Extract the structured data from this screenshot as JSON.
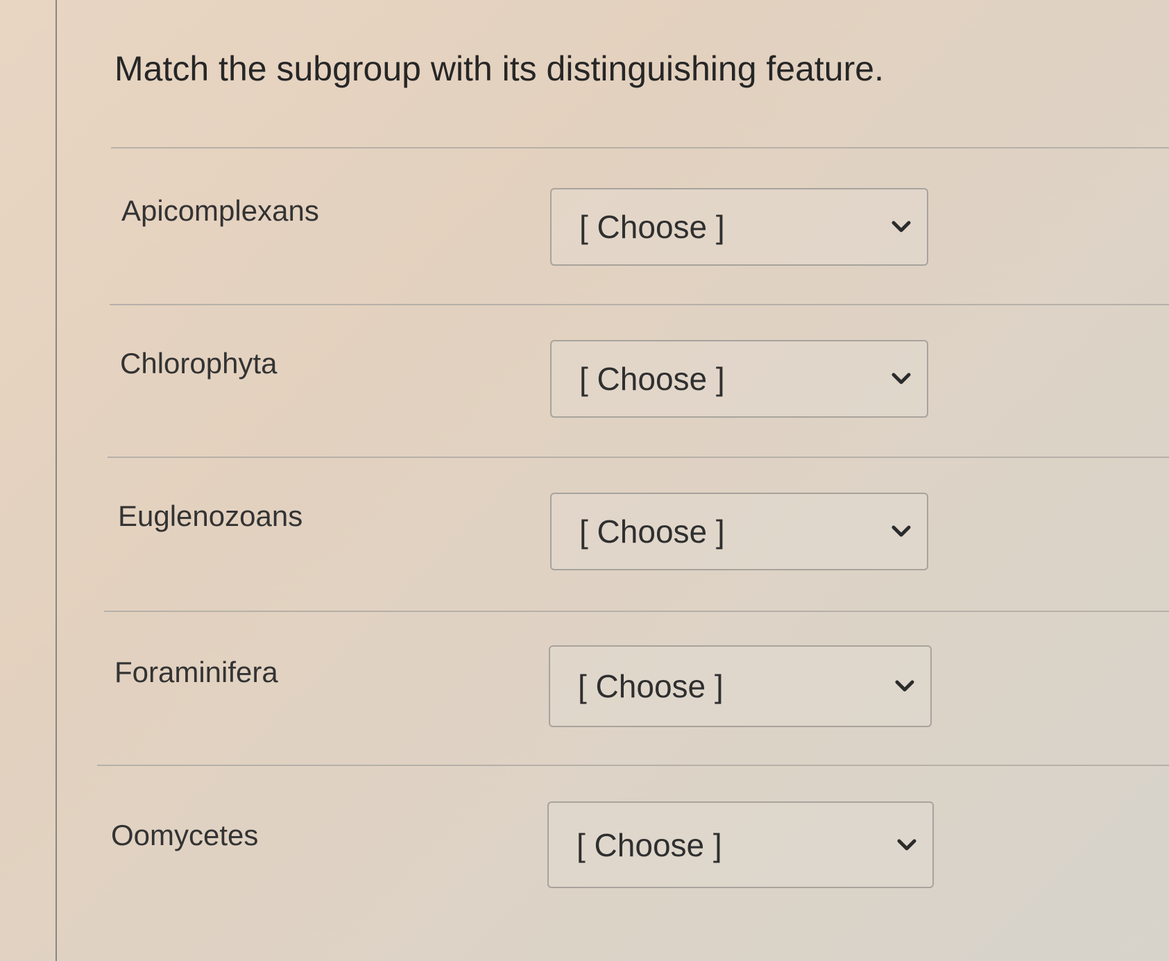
{
  "question": {
    "text": "Match the subgroup with its distinguishing feature."
  },
  "rows": [
    {
      "label": "Apicomplexans",
      "selected": "[ Choose ]",
      "icon": "chevron-down-icon"
    },
    {
      "label": "Chlorophyta",
      "selected": "[ Choose ]",
      "icon": "chevron-down-icon"
    },
    {
      "label": "Euglenozoans",
      "selected": "[ Choose ]",
      "icon": "chevron-down-icon"
    },
    {
      "label": "Foraminifera",
      "selected": "[ Choose ]",
      "icon": "chevron-down-icon"
    },
    {
      "label": "Oomycetes",
      "selected": "[ Choose ]",
      "icon": "chevron-down-icon"
    }
  ]
}
